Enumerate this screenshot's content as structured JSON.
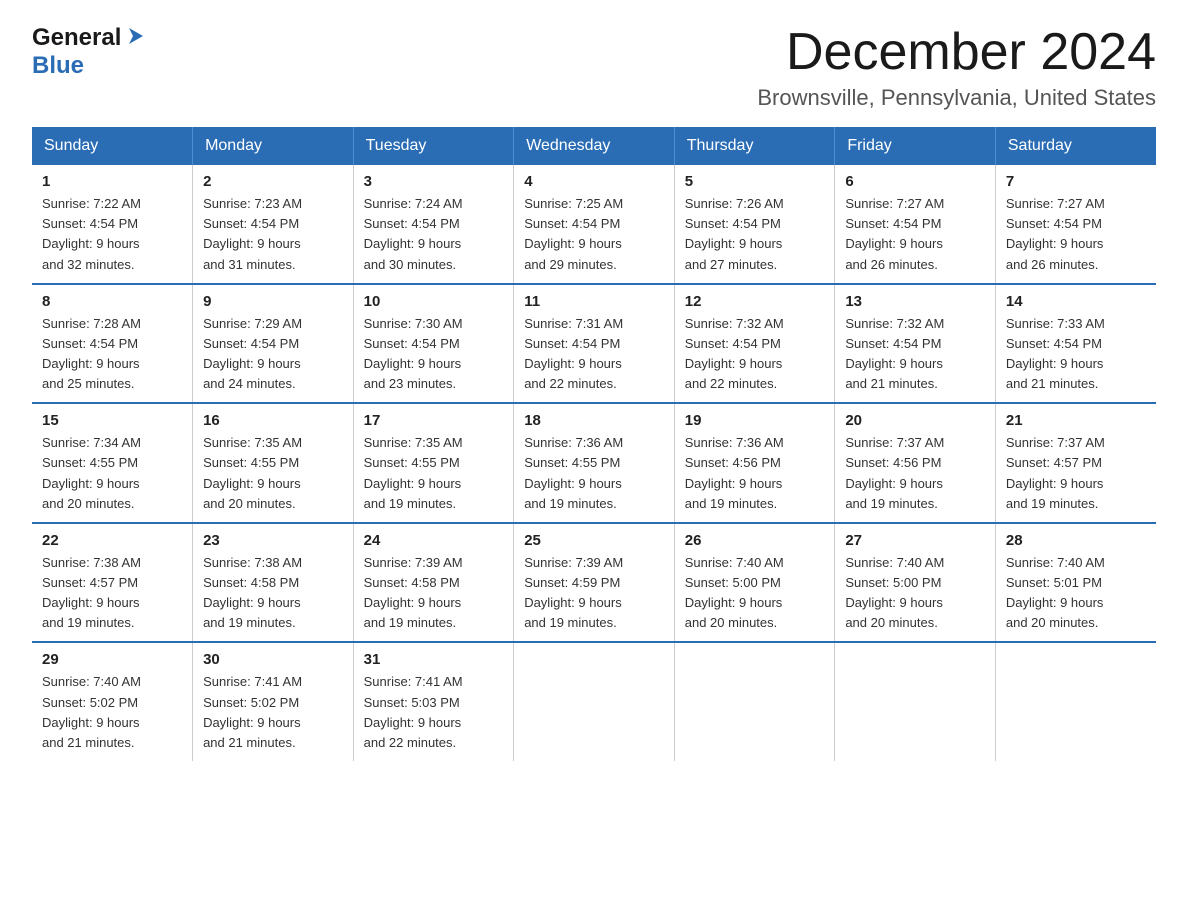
{
  "logo": {
    "general": "General",
    "blue": "Blue"
  },
  "title": "December 2024",
  "location": "Brownsville, Pennsylvania, United States",
  "weekdays": [
    "Sunday",
    "Monday",
    "Tuesday",
    "Wednesday",
    "Thursday",
    "Friday",
    "Saturday"
  ],
  "weeks": [
    [
      {
        "day": "1",
        "sunrise": "7:22 AM",
        "sunset": "4:54 PM",
        "daylight": "9 hours and 32 minutes."
      },
      {
        "day": "2",
        "sunrise": "7:23 AM",
        "sunset": "4:54 PM",
        "daylight": "9 hours and 31 minutes."
      },
      {
        "day": "3",
        "sunrise": "7:24 AM",
        "sunset": "4:54 PM",
        "daylight": "9 hours and 30 minutes."
      },
      {
        "day": "4",
        "sunrise": "7:25 AM",
        "sunset": "4:54 PM",
        "daylight": "9 hours and 29 minutes."
      },
      {
        "day": "5",
        "sunrise": "7:26 AM",
        "sunset": "4:54 PM",
        "daylight": "9 hours and 27 minutes."
      },
      {
        "day": "6",
        "sunrise": "7:27 AM",
        "sunset": "4:54 PM",
        "daylight": "9 hours and 26 minutes."
      },
      {
        "day": "7",
        "sunrise": "7:27 AM",
        "sunset": "4:54 PM",
        "daylight": "9 hours and 26 minutes."
      }
    ],
    [
      {
        "day": "8",
        "sunrise": "7:28 AM",
        "sunset": "4:54 PM",
        "daylight": "9 hours and 25 minutes."
      },
      {
        "day": "9",
        "sunrise": "7:29 AM",
        "sunset": "4:54 PM",
        "daylight": "9 hours and 24 minutes."
      },
      {
        "day": "10",
        "sunrise": "7:30 AM",
        "sunset": "4:54 PM",
        "daylight": "9 hours and 23 minutes."
      },
      {
        "day": "11",
        "sunrise": "7:31 AM",
        "sunset": "4:54 PM",
        "daylight": "9 hours and 22 minutes."
      },
      {
        "day": "12",
        "sunrise": "7:32 AM",
        "sunset": "4:54 PM",
        "daylight": "9 hours and 22 minutes."
      },
      {
        "day": "13",
        "sunrise": "7:32 AM",
        "sunset": "4:54 PM",
        "daylight": "9 hours and 21 minutes."
      },
      {
        "day": "14",
        "sunrise": "7:33 AM",
        "sunset": "4:54 PM",
        "daylight": "9 hours and 21 minutes."
      }
    ],
    [
      {
        "day": "15",
        "sunrise": "7:34 AM",
        "sunset": "4:55 PM",
        "daylight": "9 hours and 20 minutes."
      },
      {
        "day": "16",
        "sunrise": "7:35 AM",
        "sunset": "4:55 PM",
        "daylight": "9 hours and 20 minutes."
      },
      {
        "day": "17",
        "sunrise": "7:35 AM",
        "sunset": "4:55 PM",
        "daylight": "9 hours and 19 minutes."
      },
      {
        "day": "18",
        "sunrise": "7:36 AM",
        "sunset": "4:55 PM",
        "daylight": "9 hours and 19 minutes."
      },
      {
        "day": "19",
        "sunrise": "7:36 AM",
        "sunset": "4:56 PM",
        "daylight": "9 hours and 19 minutes."
      },
      {
        "day": "20",
        "sunrise": "7:37 AM",
        "sunset": "4:56 PM",
        "daylight": "9 hours and 19 minutes."
      },
      {
        "day": "21",
        "sunrise": "7:37 AM",
        "sunset": "4:57 PM",
        "daylight": "9 hours and 19 minutes."
      }
    ],
    [
      {
        "day": "22",
        "sunrise": "7:38 AM",
        "sunset": "4:57 PM",
        "daylight": "9 hours and 19 minutes."
      },
      {
        "day": "23",
        "sunrise": "7:38 AM",
        "sunset": "4:58 PM",
        "daylight": "9 hours and 19 minutes."
      },
      {
        "day": "24",
        "sunrise": "7:39 AM",
        "sunset": "4:58 PM",
        "daylight": "9 hours and 19 minutes."
      },
      {
        "day": "25",
        "sunrise": "7:39 AM",
        "sunset": "4:59 PM",
        "daylight": "9 hours and 19 minutes."
      },
      {
        "day": "26",
        "sunrise": "7:40 AM",
        "sunset": "5:00 PM",
        "daylight": "9 hours and 20 minutes."
      },
      {
        "day": "27",
        "sunrise": "7:40 AM",
        "sunset": "5:00 PM",
        "daylight": "9 hours and 20 minutes."
      },
      {
        "day": "28",
        "sunrise": "7:40 AM",
        "sunset": "5:01 PM",
        "daylight": "9 hours and 20 minutes."
      }
    ],
    [
      {
        "day": "29",
        "sunrise": "7:40 AM",
        "sunset": "5:02 PM",
        "daylight": "9 hours and 21 minutes."
      },
      {
        "day": "30",
        "sunrise": "7:41 AM",
        "sunset": "5:02 PM",
        "daylight": "9 hours and 21 minutes."
      },
      {
        "day": "31",
        "sunrise": "7:41 AM",
        "sunset": "5:03 PM",
        "daylight": "9 hours and 22 minutes."
      },
      null,
      null,
      null,
      null
    ]
  ],
  "labels": {
    "sunrise": "Sunrise:",
    "sunset": "Sunset:",
    "daylight": "Daylight:"
  }
}
